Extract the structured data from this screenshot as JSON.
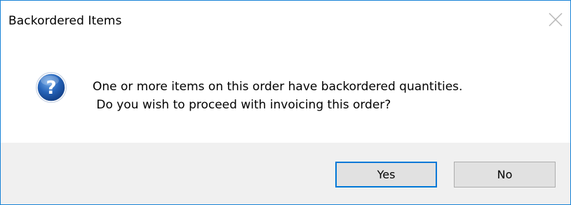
{
  "dialog": {
    "title": "Backordered Items",
    "close_icon": "close-icon",
    "icon": "question-icon",
    "message_line1": "One or more items on this order have backordered quantities.",
    "message_line2": " Do you wish to proceed with invoicing this order?",
    "buttons": {
      "yes_label": "Yes",
      "no_label": "No"
    }
  },
  "colors": {
    "window_border": "#1883d7",
    "footer_bg": "#f0f0f0",
    "button_bg": "#e1e1e1",
    "default_button_border": "#0078d7",
    "icon_blue": "#1d5fb4"
  }
}
